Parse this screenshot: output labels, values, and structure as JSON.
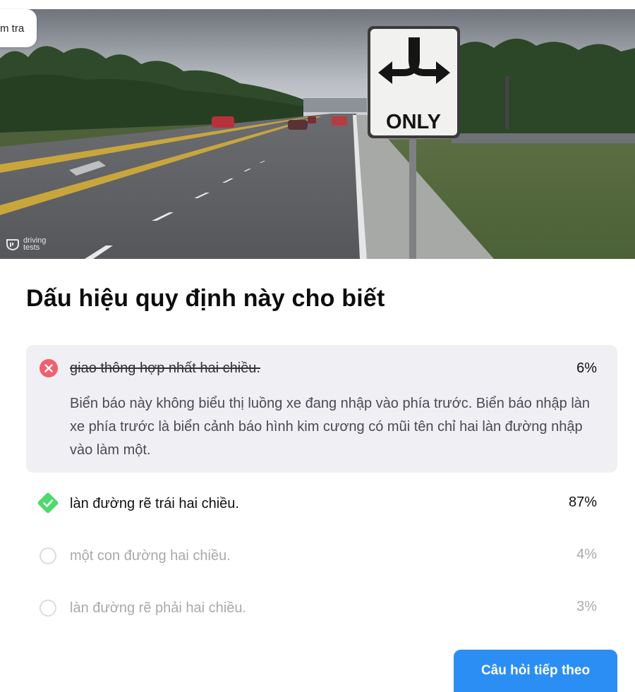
{
  "header": {
    "check_pill_label": "m tra",
    "watermark_line1": "driving",
    "watermark_line2": "tests"
  },
  "scene": {
    "sign_text": "ONLY"
  },
  "question": {
    "title": "Dấu hiệu quy định này cho biết"
  },
  "answers": [
    {
      "text": "giao thông hợp nhất hai chiều.",
      "percent": "6%",
      "state": "wrong",
      "explanation": "Biển báo này không biểu thị luồng xe đang nhập vào phía trước. Biển báo nhập làn xe phía trước là biển cảnh báo hình kim cương có mũi tên chỉ hai làn đường nhập vào làm một."
    },
    {
      "text": "làn đường rẽ trái hai chiều.",
      "percent": "87%",
      "state": "correct"
    },
    {
      "text": "một con đường hai chiều.",
      "percent": "4%",
      "state": "unselected"
    },
    {
      "text": "làn đường rẽ phải hai chiều.",
      "percent": "3%",
      "state": "unselected"
    }
  ],
  "footer": {
    "next_label": "Câu hỏi tiếp theo"
  },
  "colors": {
    "wrong": "#f0606e",
    "correct": "#4cdb6a",
    "primary": "#2b8ef5",
    "wrong_bg": "#f0eff4"
  }
}
